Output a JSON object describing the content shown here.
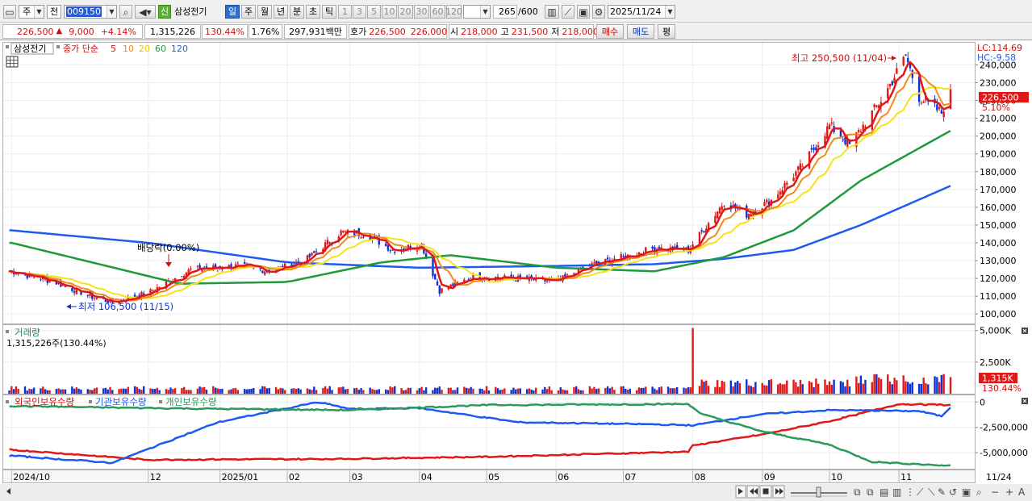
{
  "toolbar": {
    "market_type": "주",
    "scope": "전",
    "code": "009150",
    "new_badge": "신",
    "stock_name": "삼성전기",
    "periods": [
      "일",
      "주",
      "월",
      "년",
      "분",
      "초",
      "틱"
    ],
    "active_period": "일",
    "intervals": [
      "1",
      "3",
      "5",
      "10",
      "20",
      "30",
      "60",
      "120"
    ],
    "count": "265",
    "count_max": "/600",
    "date": "2025/11/24"
  },
  "quote": {
    "price": "226,500",
    "change_arrow": "▲",
    "change": "9,000",
    "change_pct": "+4.14%",
    "volume": "1,315,226",
    "volume_ratio": "130.44%",
    "turnover": "1.76%",
    "amount": "297,931백만",
    "bid_label": "호가",
    "ask_price": "226,500",
    "bid_price": "226,000",
    "open_label": "시",
    "open": "218,000",
    "high_label": "고",
    "high": "231,500",
    "low_label": "저",
    "low": "218,000",
    "buy_button": "매수",
    "sell_button": "매도",
    "avg_button": "평"
  },
  "price_panel": {
    "legend_name": "삼성전기",
    "legend_series": "종가 단순",
    "ma_labels": [
      "5",
      "10",
      "20",
      "60",
      "120"
    ],
    "lc_label": "LC:114.69",
    "hc_label": "HC:-9.58",
    "high_annotation": "최고 250,500 (11/04)",
    "low_annotation": "최저 106,500 (11/15)",
    "dividend_annotation": "배당락(0.00%)",
    "current_price_tag": "226,500",
    "current_pct_tag": "5.10%"
  },
  "volume_panel": {
    "title": "거래량",
    "value_text": "1,315,226주(130.44%)",
    "tag_value": "1,315K",
    "tag_pct": "130.44%"
  },
  "holding_panel": {
    "series_labels": [
      "외국인보유수량",
      "기관보유수량",
      "개인보유수량"
    ]
  },
  "colors": {
    "up": "#e01818",
    "down": "#1030d0",
    "ma5": "#e01818",
    "ma10": "#f08c1e",
    "ma20": "#f5e31a",
    "ma60": "#1e9a3c",
    "ma120": "#1e5af0",
    "foreign": "#e01818",
    "institution": "#1e5af0",
    "individual": "#2a9a5a"
  },
  "chart_data": [
    {
      "type": "candlestick",
      "title": "삼성전기",
      "x_ticks": [
        "2024/10",
        "12",
        "2025/01",
        "02",
        "03",
        "04",
        "05",
        "06",
        "07",
        "08",
        "09",
        "10",
        "11",
        "11/24"
      ],
      "y_ticks": [
        "100,000",
        "110,000",
        "120,000",
        "130,000",
        "140,000",
        "150,000",
        "160,000",
        "170,000",
        "180,000",
        "190,000",
        "200,000",
        "210,000",
        "220,000",
        "230,000",
        "240,000"
      ],
      "ylim": [
        96000,
        252000
      ],
      "x_range": [
        "2024-10",
        "2025-11-24"
      ],
      "anchors": [
        [
          "2024-10-01",
          124000
        ],
        [
          "2024-10-20",
          118000
        ],
        [
          "2024-11-05",
          110000
        ],
        [
          "2024-11-15",
          106500
        ],
        [
          "2024-12-01",
          112000
        ],
        [
          "2024-12-20",
          125000
        ],
        [
          "2025-01-10",
          127000
        ],
        [
          "2025-01-25",
          124000
        ],
        [
          "2025-02-10",
          131000
        ],
        [
          "2025-02-25",
          146000
        ],
        [
          "2025-03-08",
          145000
        ],
        [
          "2025-03-20",
          136000
        ],
        [
          "2025-04-02",
          139000
        ],
        [
          "2025-04-10",
          113000
        ],
        [
          "2025-04-25",
          121000
        ],
        [
          "2025-05-15",
          120000
        ],
        [
          "2025-06-01",
          118000
        ],
        [
          "2025-06-15",
          127000
        ],
        [
          "2025-07-01",
          132000
        ],
        [
          "2025-07-15",
          137000
        ],
        [
          "2025-07-30",
          136000
        ],
        [
          "2025-08-15",
          163000
        ],
        [
          "2025-08-25",
          156000
        ],
        [
          "2025-09-05",
          164000
        ],
        [
          "2025-09-20",
          185000
        ],
        [
          "2025-10-01",
          206000
        ],
        [
          "2025-10-10",
          195000
        ],
        [
          "2025-10-25",
          222000
        ],
        [
          "2025-11-04",
          245000
        ],
        [
          "2025-11-10",
          222000
        ],
        [
          "2025-11-20",
          213000
        ],
        [
          "2025-11-24",
          226500
        ]
      ],
      "ma60_anchors": [
        [
          "2024-10-01",
          140000
        ],
        [
          "2024-12-15",
          117000
        ],
        [
          "2025-02-01",
          118000
        ],
        [
          "2025-03-15",
          129000
        ],
        [
          "2025-04-15",
          133000
        ],
        [
          "2025-06-01",
          126000
        ],
        [
          "2025-07-15",
          124000
        ],
        [
          "2025-08-15",
          132000
        ],
        [
          "2025-09-15",
          147000
        ],
        [
          "2025-10-15",
          175000
        ],
        [
          "2025-11-24",
          203000
        ]
      ],
      "ma120_anchors": [
        [
          "2024-10-01",
          147000
        ],
        [
          "2024-12-01",
          140000
        ],
        [
          "2025-02-01",
          129000
        ],
        [
          "2025-04-01",
          126000
        ],
        [
          "2025-06-01",
          127000
        ],
        [
          "2025-07-15",
          128000
        ],
        [
          "2025-08-15",
          131000
        ],
        [
          "2025-09-15",
          136000
        ],
        [
          "2025-10-15",
          150000
        ],
        [
          "2025-11-24",
          172000
        ]
      ]
    },
    {
      "type": "bar",
      "title": "거래량",
      "y_ticks": [
        "5,000K",
        "2,500K"
      ],
      "ylim": [
        0,
        5300
      ],
      "unit": "K",
      "spike": [
        "2025-08-01",
        5200
      ]
    },
    {
      "type": "line",
      "y_ticks": [
        "0",
        "-2,500,000",
        "-5,000,000"
      ],
      "ylim": [
        -6500000,
        500000
      ],
      "series": [
        {
          "name": "외국인보유수량",
          "anchors": [
            [
              "2024-10-01",
              -4700000
            ],
            [
              "2024-12-01",
              -5700000
            ],
            [
              "2025-03-01",
              -5600000
            ],
            [
              "2025-05-01",
              -5400000
            ],
            [
              "2025-07-30",
              -4900000
            ],
            [
              "2025-08-01",
              -4300000
            ],
            [
              "2025-09-01",
              -3200000
            ],
            [
              "2025-10-01",
              -1900000
            ],
            [
              "2025-11-01",
              -200000
            ],
            [
              "2025-11-24",
              -300000
            ]
          ]
        },
        {
          "name": "기관보유수량",
          "anchors": [
            [
              "2024-10-01",
              -5300000
            ],
            [
              "2024-11-15",
              -6000000
            ],
            [
              "2025-01-01",
              -2000000
            ],
            [
              "2025-02-15",
              0
            ],
            [
              "2025-03-01",
              -700000
            ],
            [
              "2025-04-01",
              -600000
            ],
            [
              "2025-05-15",
              -2000000
            ],
            [
              "2025-07-15",
              -2200000
            ],
            [
              "2025-08-01",
              -2300000
            ],
            [
              "2025-09-01",
              -1200000
            ],
            [
              "2025-10-01",
              -800000
            ],
            [
              "2025-11-10",
              -900000
            ],
            [
              "2025-11-20",
              -1400000
            ],
            [
              "2025-11-24",
              -500000
            ]
          ]
        },
        {
          "name": "개인보유수량",
          "anchors": [
            [
              "2024-10-01",
              -400000
            ],
            [
              "2024-12-01",
              -600000
            ],
            [
              "2025-03-01",
              -800000
            ],
            [
              "2025-05-01",
              -300000
            ],
            [
              "2025-07-30",
              -200000
            ],
            [
              "2025-08-05",
              -1200000
            ],
            [
              "2025-09-01",
              -2900000
            ],
            [
              "2025-10-01",
              -4200000
            ],
            [
              "2025-10-20",
              -5900000
            ],
            [
              "2025-11-24",
              -6300000
            ]
          ]
        }
      ]
    }
  ],
  "x_axis": {
    "labels": [
      "2024/10",
      "12",
      "2025/01",
      "02",
      "03",
      "04",
      "05",
      "06",
      "07",
      "08",
      "09",
      "10",
      "11"
    ],
    "last_label": "11/24"
  }
}
